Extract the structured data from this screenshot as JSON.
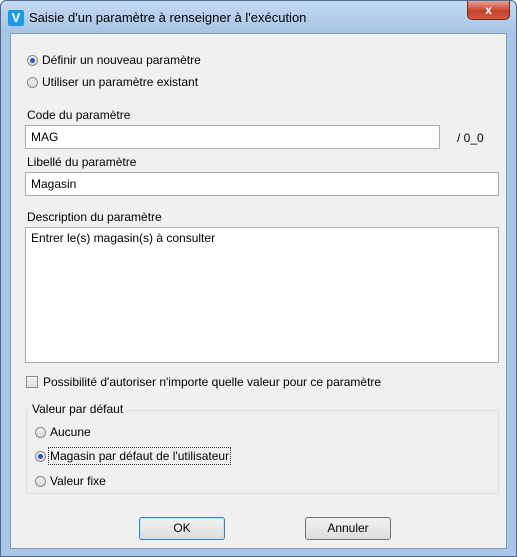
{
  "window": {
    "title": "Saisie d'un paramètre à renseigner à l'exécution",
    "app_icon_letter": "V",
    "close_label": "x"
  },
  "mode": {
    "options": [
      {
        "label": "Définir un nouveau paramètre",
        "selected": true
      },
      {
        "label": "Utiliser un paramètre existant",
        "selected": false
      }
    ]
  },
  "code": {
    "label": "Code du paramètre",
    "value": "MAG",
    "suffix": "/ 0_0"
  },
  "libelle": {
    "label": "Libellé du paramètre",
    "value": "Magasin"
  },
  "description": {
    "label": "Description du paramètre",
    "value": "Entrer le(s) magasin(s) à consulter"
  },
  "allow_any": {
    "label": "Possibilité d'autoriser n'importe quelle valeur pour ce paramètre",
    "checked": false
  },
  "default_value": {
    "title": "Valeur par défaut",
    "options": [
      {
        "label": "Aucune",
        "selected": false
      },
      {
        "label": "Magasin par défaut de l'utilisateur",
        "selected": true
      },
      {
        "label": "Valeur fixe",
        "selected": false
      }
    ]
  },
  "buttons": {
    "ok": "OK",
    "cancel": "Annuler"
  }
}
